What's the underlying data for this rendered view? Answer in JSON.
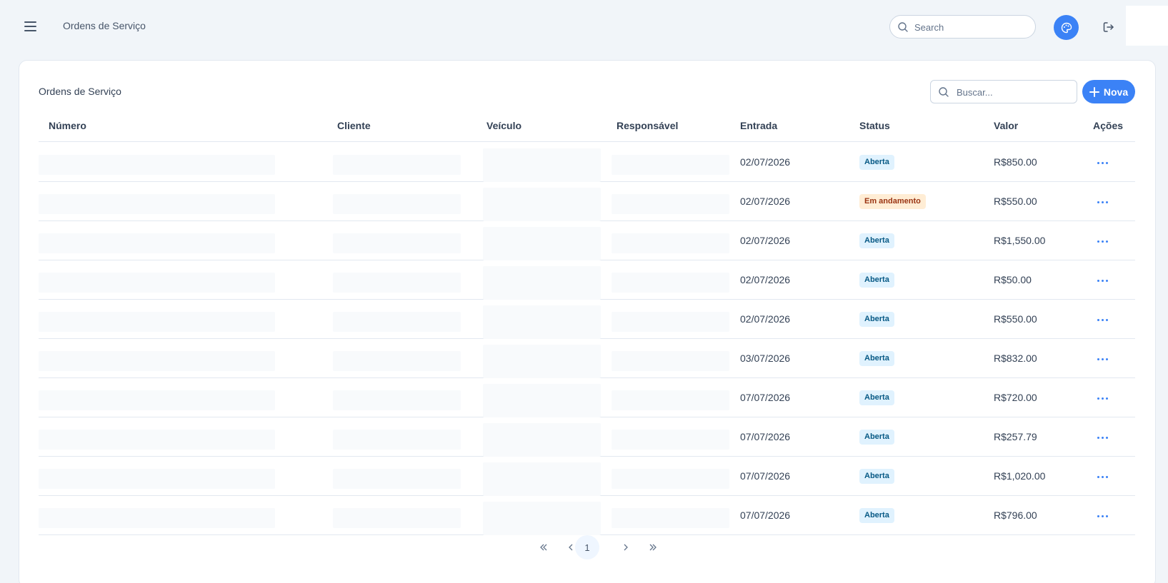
{
  "header": {
    "title": "Ordens de Serviço",
    "search_placeholder": "Search"
  },
  "card": {
    "title": "Ordens de Serviço",
    "search_placeholder": "Buscar...",
    "new_button": "Nova"
  },
  "table": {
    "columns": [
      "Número",
      "Cliente",
      "Veículo",
      "Responsável",
      "Entrada",
      "Status",
      "Valor",
      "Ações"
    ],
    "rows": [
      {
        "entrada": "02/07/2026",
        "status": "Aberta",
        "valor": "R$850.00"
      },
      {
        "entrada": "02/07/2026",
        "status": "Em andamento",
        "valor": "R$550.00"
      },
      {
        "entrada": "02/07/2026",
        "status": "Aberta",
        "valor": "R$1,550.00"
      },
      {
        "entrada": "02/07/2026",
        "status": "Aberta",
        "valor": "R$50.00"
      },
      {
        "entrada": "02/07/2026",
        "status": "Aberta",
        "valor": "R$550.00"
      },
      {
        "entrada": "03/07/2026",
        "status": "Aberta",
        "valor": "R$832.00"
      },
      {
        "entrada": "07/07/2026",
        "status": "Aberta",
        "valor": "R$720.00"
      },
      {
        "entrada": "07/07/2026",
        "status": "Aberta",
        "valor": "R$257.79"
      },
      {
        "entrada": "07/07/2026",
        "status": "Aberta",
        "valor": "R$1,020.00"
      },
      {
        "entrada": "07/07/2026",
        "status": "Aberta",
        "valor": "R$796.00"
      }
    ]
  },
  "pagination": {
    "current_page": "1",
    "icons": [
      "first-page-icon",
      "prev-page-icon",
      "next-page-icon",
      "last-page-icon"
    ]
  },
  "colors": {
    "accent": "#3b82f6",
    "status_open_bg": "#e0f2fe",
    "status_open_text": "#075985",
    "status_progress_bg": "#ffedd5",
    "status_progress_text": "#9a3412"
  }
}
